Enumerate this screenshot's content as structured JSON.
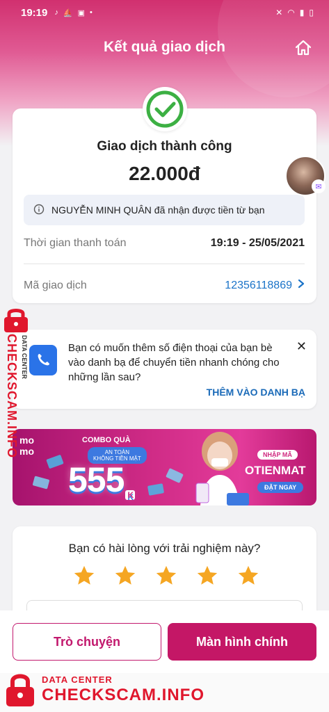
{
  "status_bar": {
    "time": "19:19",
    "icons": [
      "tiktok-icon",
      "boat-icon",
      "shop-icon",
      "dot-icon"
    ],
    "right_icons": [
      "mute-icon",
      "wifi-icon",
      "signal-icon",
      "battery-icon"
    ]
  },
  "header": {
    "title": "Kết quả giao dịch"
  },
  "result": {
    "title": "Giao dịch thành công",
    "amount": "22.000đ",
    "info": "NGUYỄN MINH QUÂN đã nhận được tiền từ bạn",
    "payment_time_label": "Thời gian thanh toán",
    "payment_time_value": "19:19 - 25/05/2021",
    "txn_id_label": "Mã giao dịch",
    "txn_id_value": "12356118869"
  },
  "contact_prompt": {
    "message": "Bạn có muốn thêm số điện thoại của bạn bè vào danh bạ để chuyển tiền nhanh chóng cho những lần sau?",
    "action": "THÊM VÀO DANH BẠ",
    "close": "✕"
  },
  "promo": {
    "brand_line1": "mo",
    "brand_line2": "mo",
    "combo": "COMBO QUÀ",
    "safe_line1": "AN TOÀN",
    "safe_line2": "KHÔNG TIỀN MẶT",
    "amount": "555",
    "amount_unit": "K",
    "code_label": "NHẬP MÃ",
    "code": "OTIENMAT",
    "order": "ĐẶT NGAY"
  },
  "rating": {
    "question": "Bạn có hài lòng với trải nghiệm này?",
    "stars": 5,
    "star_color": "#f5a623"
  },
  "buttons": {
    "chat": "Trò chuyện",
    "home": "Màn hình chính"
  },
  "watermark": {
    "side_small": "DATA CENTER",
    "side_big": "CHECKSCAM.INFO",
    "bottom_small": "DATA CENTER",
    "bottom_big": "CHECKSCAM.INFO"
  },
  "colors": {
    "brand": "#c41766",
    "link": "#1a73c8",
    "success": "#3cb043",
    "watermark": "#e0172d"
  }
}
